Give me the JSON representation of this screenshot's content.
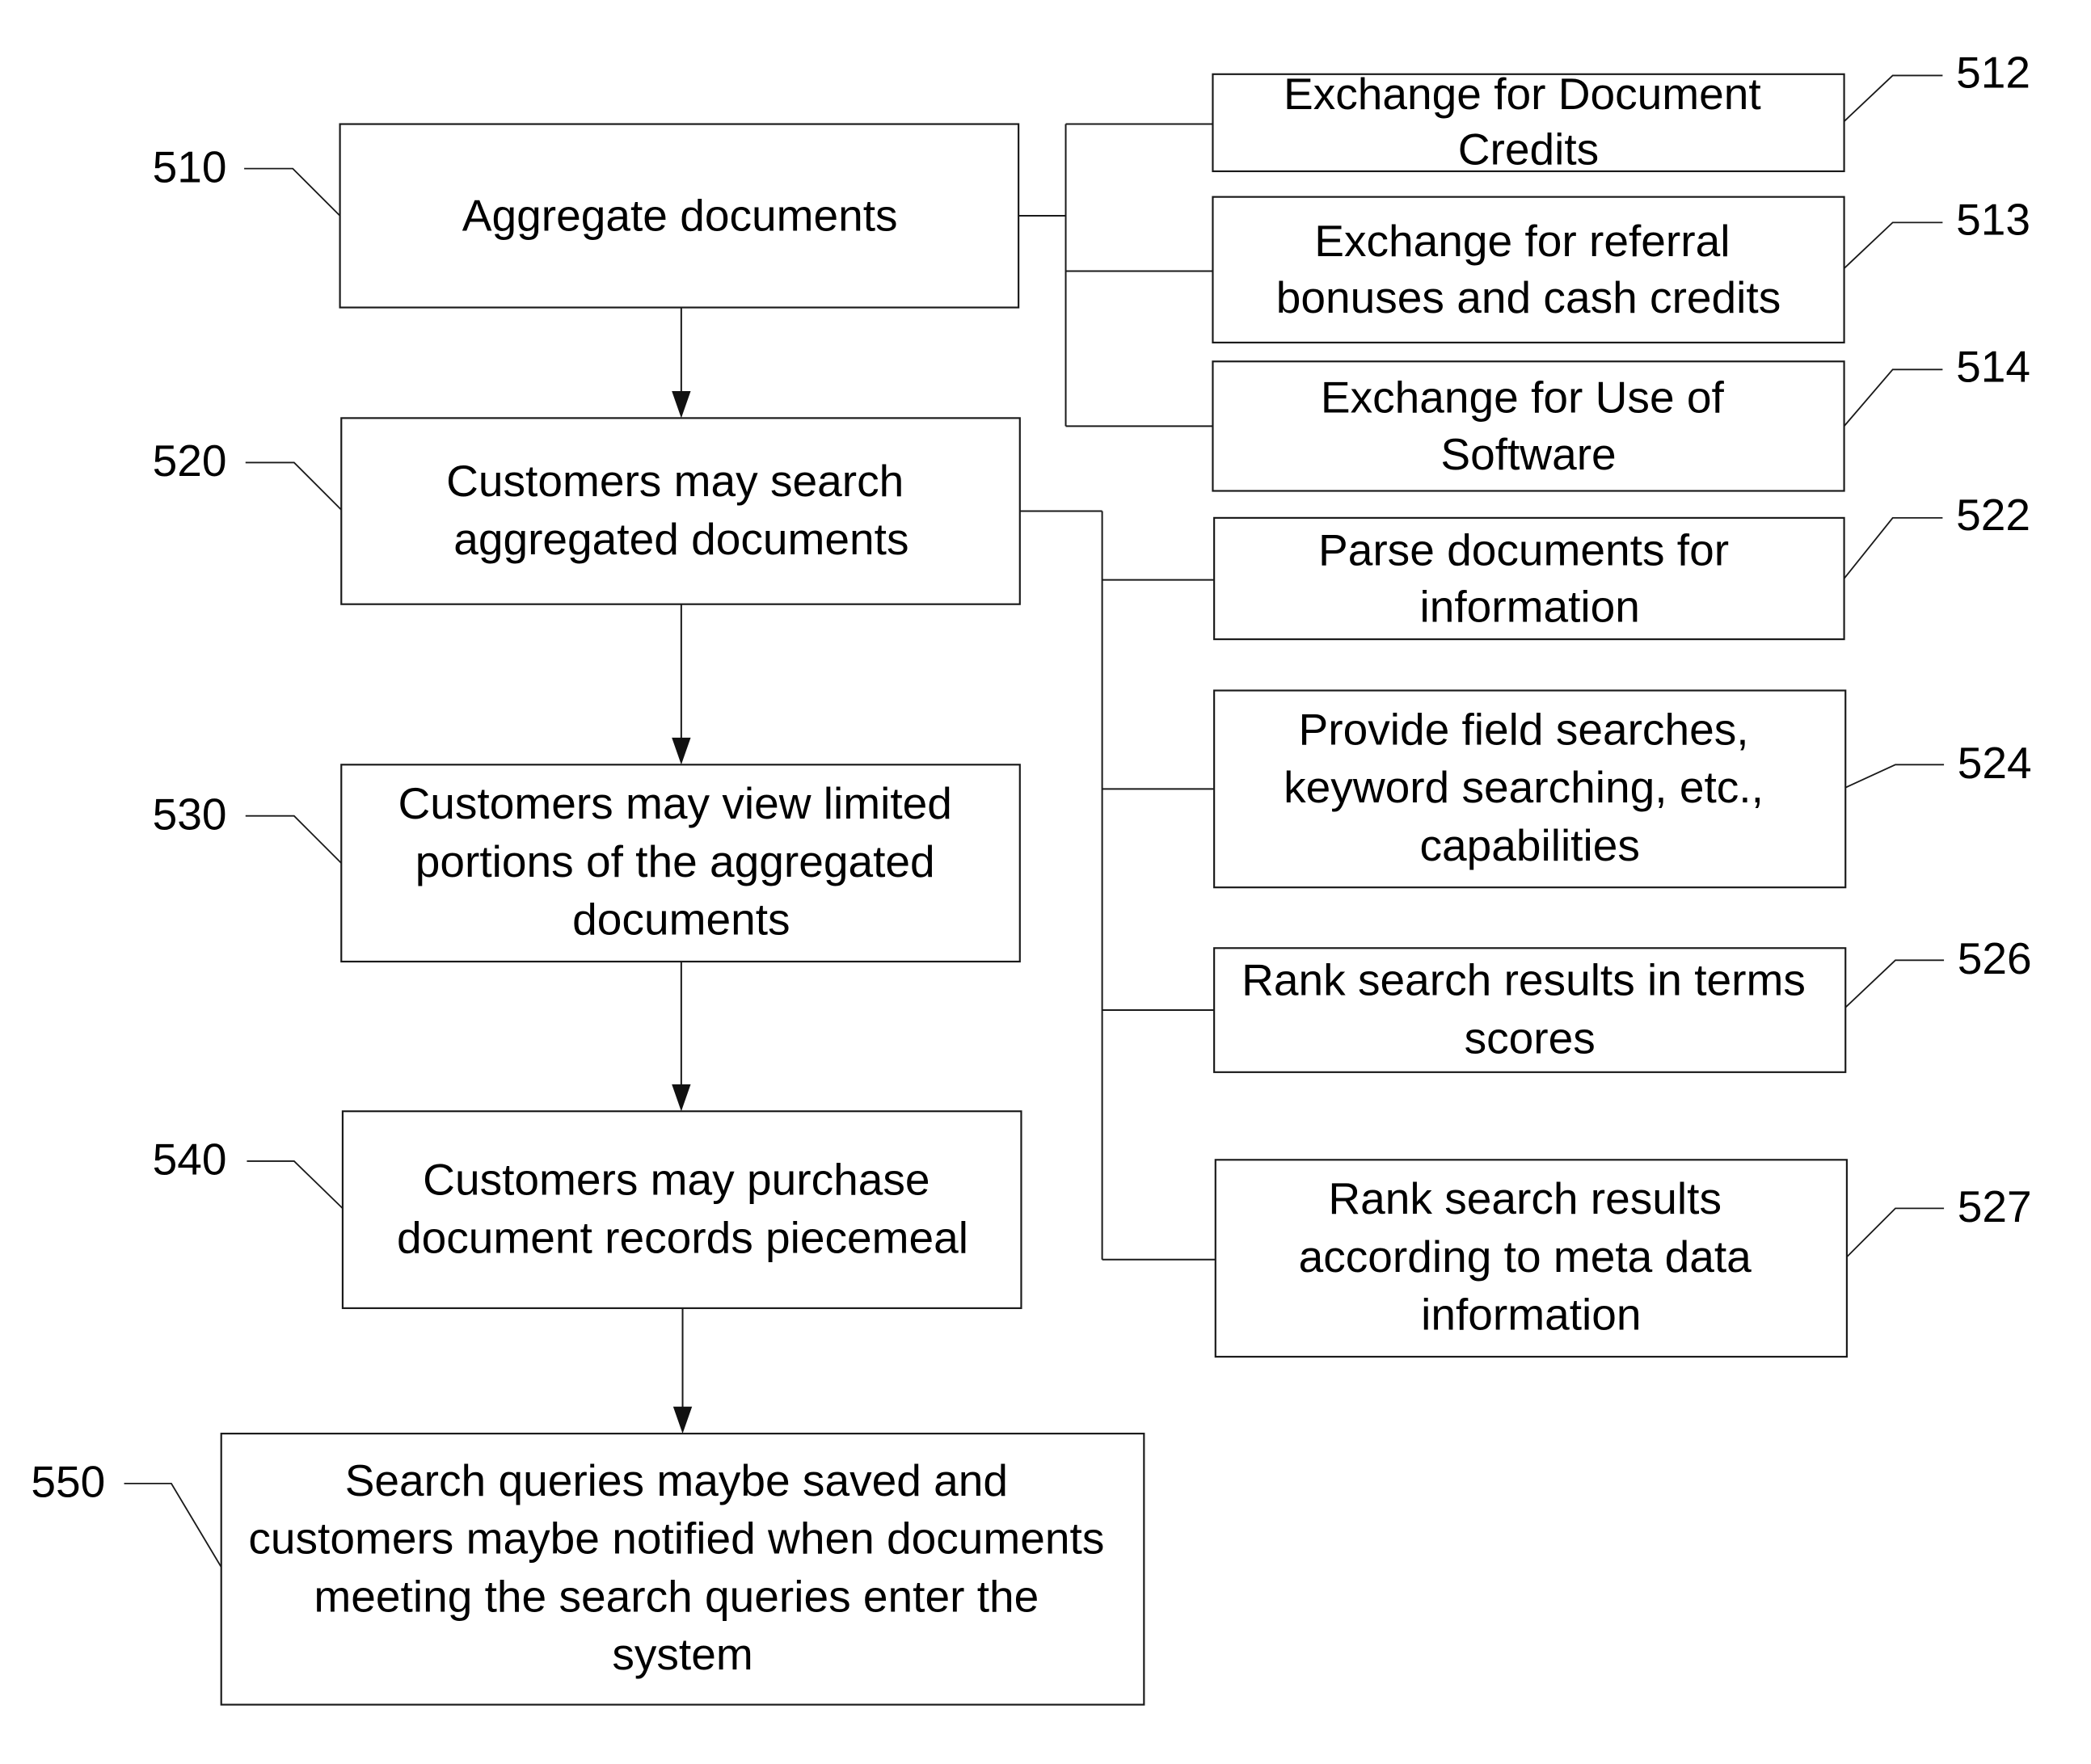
{
  "diagram": {
    "type": "flowchart",
    "colors": {
      "line": "#1a1a1a",
      "text": "#000000",
      "background": "#ffffff"
    },
    "main_steps": [
      {
        "ref": "510",
        "lines": [
          "Aggregate documents"
        ]
      },
      {
        "ref": "520",
        "lines": [
          "Customers may search",
          "aggregated documents"
        ]
      },
      {
        "ref": "530",
        "lines": [
          "Customers may view limited",
          "portions of the aggregated",
          "documents"
        ]
      },
      {
        "ref": "540",
        "lines": [
          "Customers may purchase",
          "document records piecemeal"
        ]
      },
      {
        "ref": "550",
        "lines": [
          "Search queries maybe saved and",
          "customers maybe notified when documents",
          "meeting the search queries enter the",
          "system"
        ]
      }
    ],
    "branches_510": [
      {
        "ref": "512",
        "lines": [
          "Exchange for Document",
          "Credits"
        ]
      },
      {
        "ref": "513",
        "lines": [
          "Exchange for referral",
          "bonuses and cash credits"
        ]
      },
      {
        "ref": "514",
        "lines": [
          "Exchange for Use of",
          "Software"
        ]
      }
    ],
    "branches_520": [
      {
        "ref": "522",
        "lines": [
          "Parse documents for",
          "information"
        ]
      },
      {
        "ref": "524",
        "lines": [
          "Provide field searches,",
          "keyword searching, etc.,",
          "capabilities"
        ]
      },
      {
        "ref": "526",
        "lines": [
          "Rank search results in terms",
          "scores"
        ]
      },
      {
        "ref": "527",
        "lines": [
          "Rank search results",
          "according to meta data",
          "information"
        ]
      }
    ],
    "edges": [
      {
        "from": "510",
        "to": "520"
      },
      {
        "from": "520",
        "to": "530"
      },
      {
        "from": "530",
        "to": "540"
      },
      {
        "from": "540",
        "to": "550"
      },
      {
        "from": "510",
        "to": "512"
      },
      {
        "from": "510",
        "to": "513"
      },
      {
        "from": "510",
        "to": "514"
      },
      {
        "from": "520",
        "to": "522"
      },
      {
        "from": "520",
        "to": "524"
      },
      {
        "from": "520",
        "to": "526"
      },
      {
        "from": "520",
        "to": "527"
      }
    ]
  }
}
